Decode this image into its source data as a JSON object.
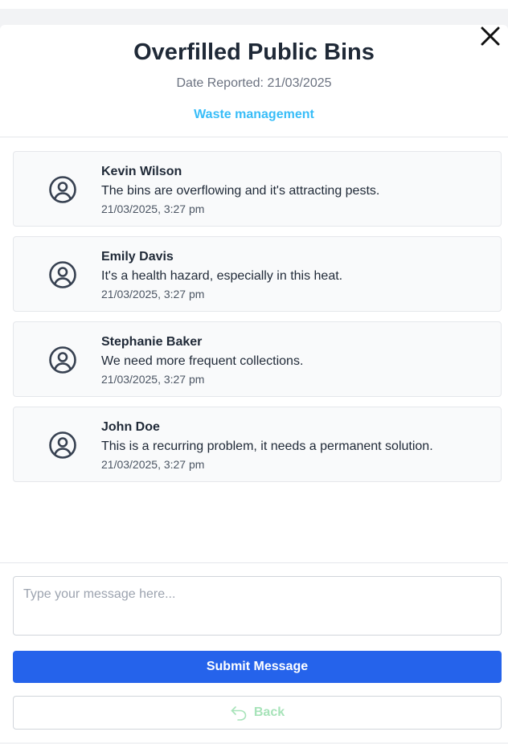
{
  "modal": {
    "title": "Overfilled Public Bins",
    "date_reported": "Date Reported: 21/03/2025",
    "category": "Waste management",
    "close_icon": "close-icon"
  },
  "comments": [
    {
      "author": "Kevin Wilson",
      "text": "The bins are overflowing and it's attracting pests.",
      "time": "21/03/2025, 3:27 pm",
      "icon": "user-circle-icon"
    },
    {
      "author": "Emily Davis",
      "text": "It's a health hazard, especially in this heat.",
      "time": "21/03/2025, 3:27 pm",
      "icon": "user-circle-icon"
    },
    {
      "author": "Stephanie Baker",
      "text": "We need more frequent collections.",
      "time": "21/03/2025, 3:27 pm",
      "icon": "user-circle-icon"
    },
    {
      "author": "John Doe",
      "text": "This is a recurring problem, it needs a permanent solution.",
      "time": "21/03/2025, 3:27 pm",
      "icon": "user-circle-icon"
    }
  ],
  "form": {
    "message_placeholder": "Type your message here...",
    "message_value": "",
    "submit_label": "Submit Message",
    "back_label": "Back",
    "back_icon": "undo-arrow-icon"
  },
  "colors": {
    "primary": "#2563eb",
    "category": "#38bdf8",
    "back_text": "#a7e3b9"
  }
}
